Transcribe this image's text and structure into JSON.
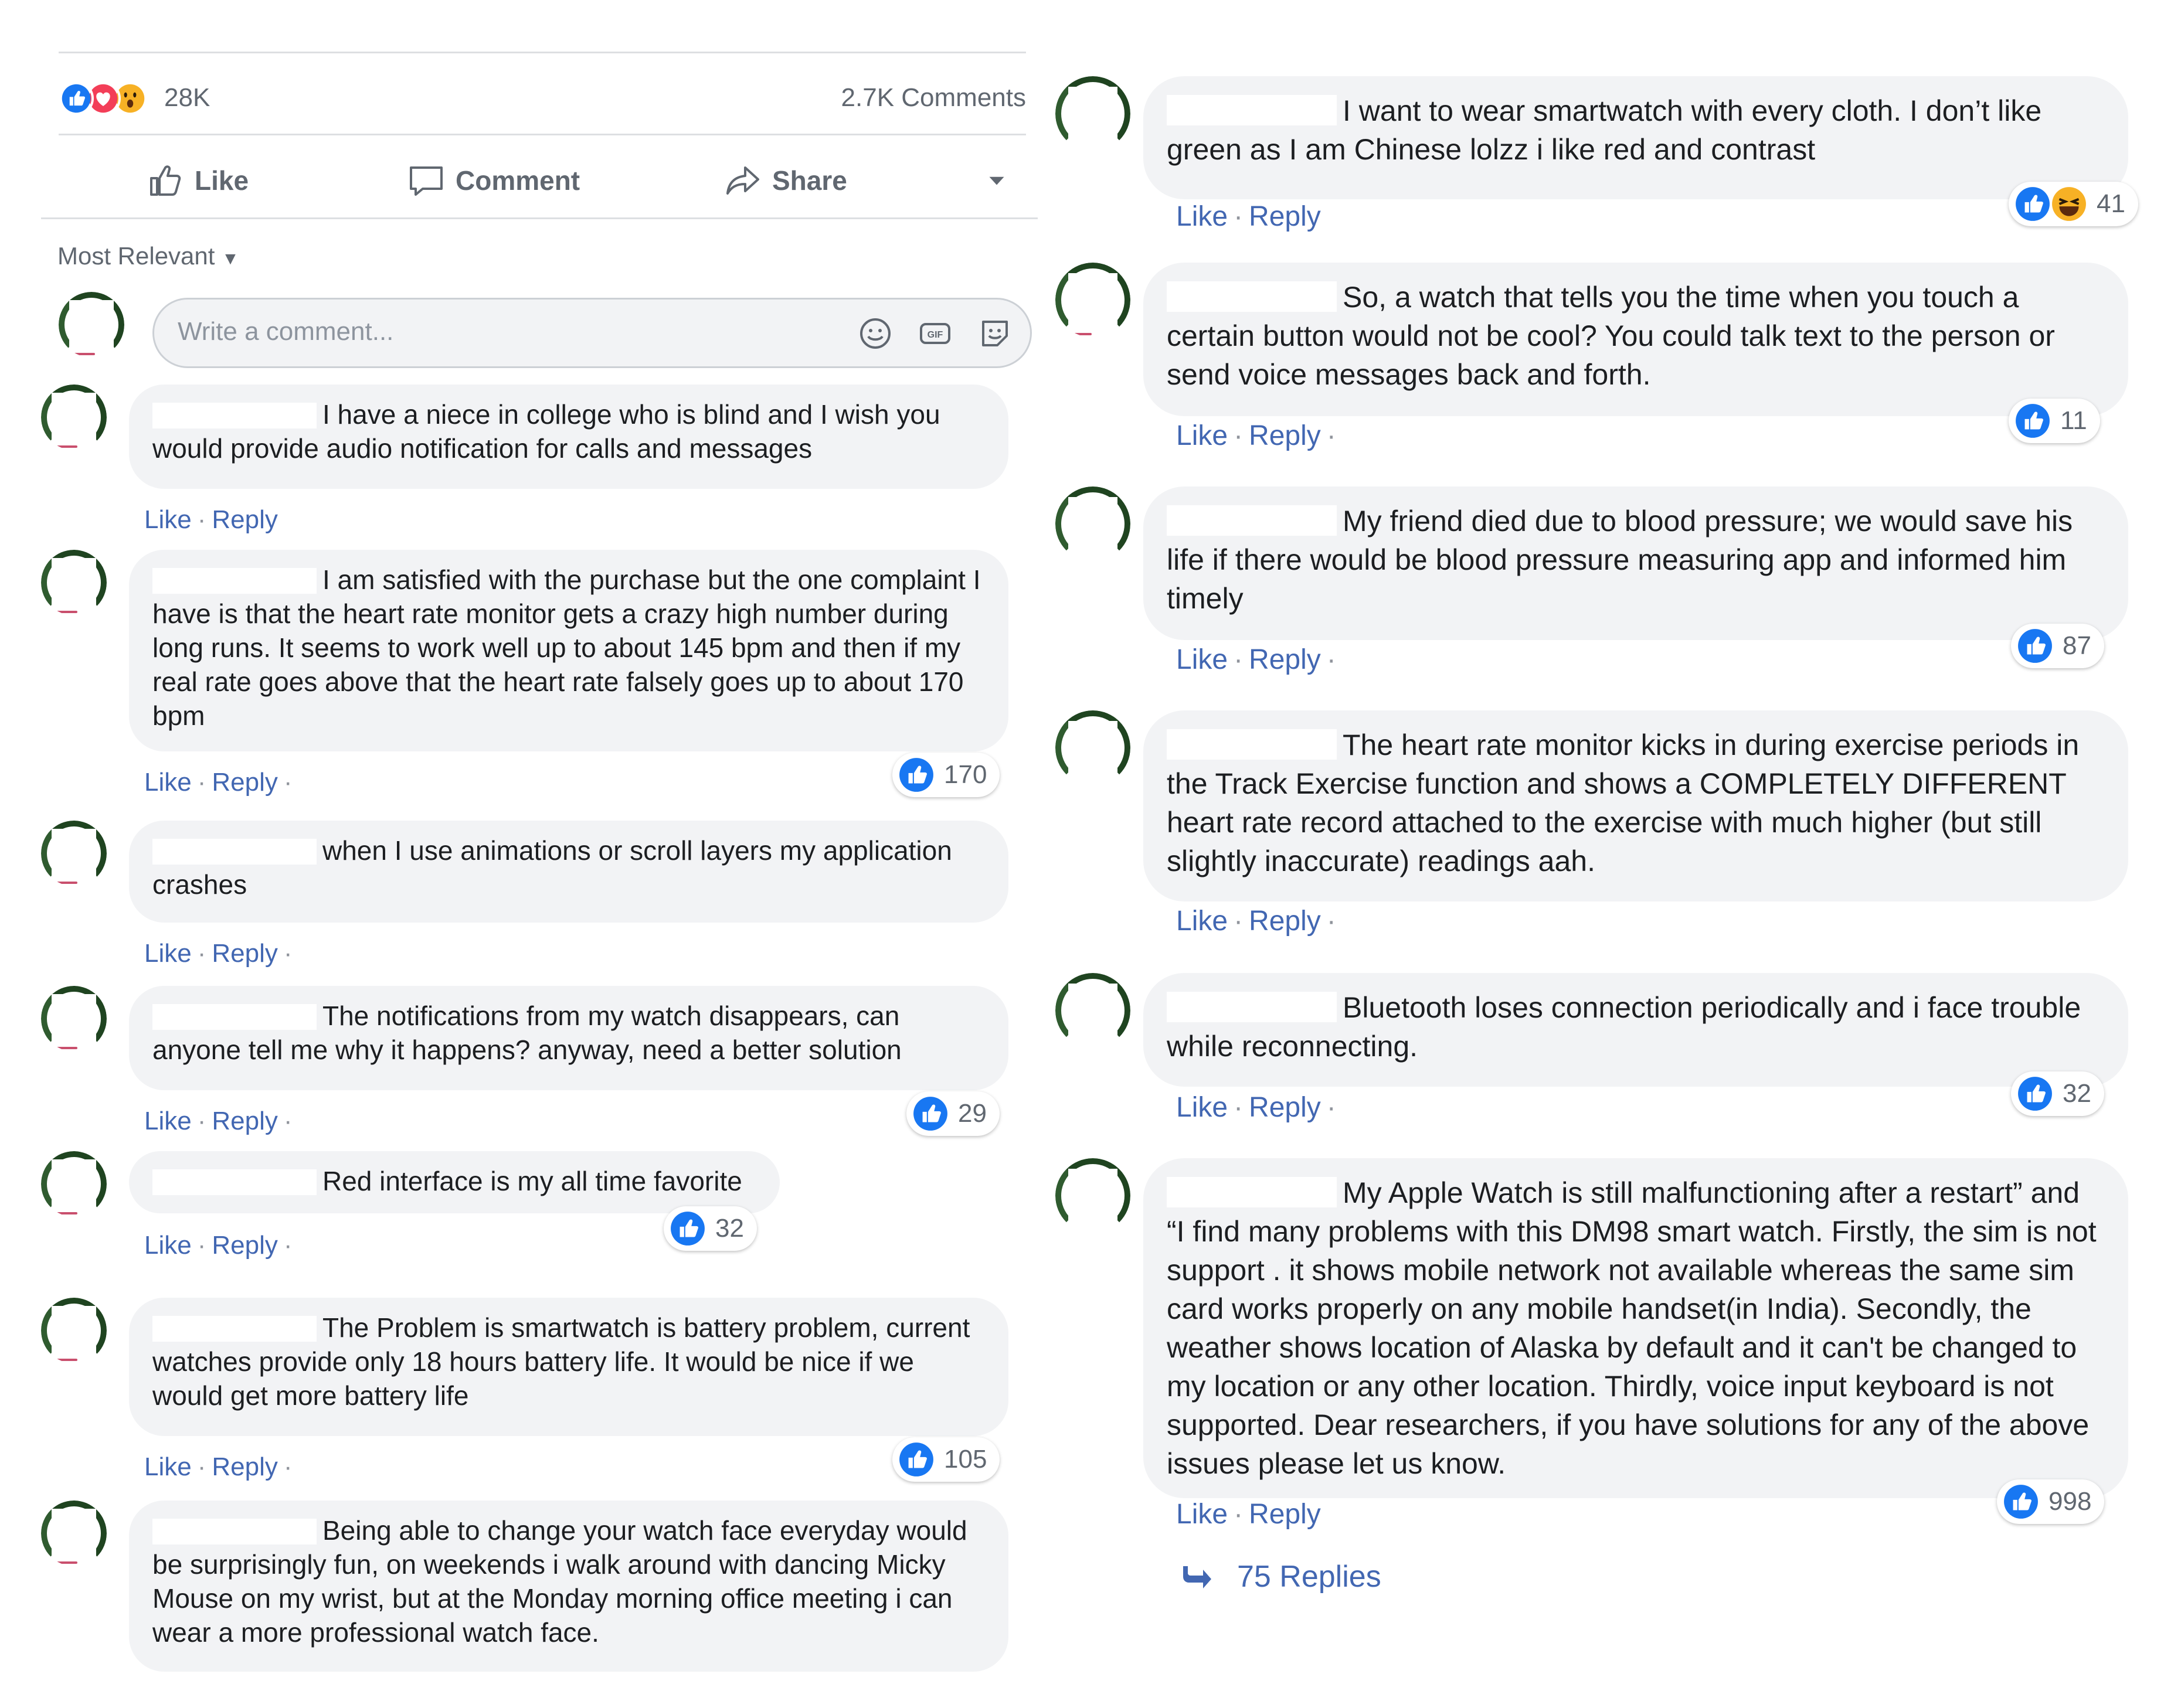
{
  "summary": {
    "reaction_count": "28K",
    "comments_count": "2.7K Comments",
    "reaction_icons": [
      "like-icon",
      "love-icon",
      "wow-icon"
    ]
  },
  "actions": {
    "like": "Like",
    "comment": "Comment",
    "share": "Share"
  },
  "sort": {
    "label": "Most Relevant"
  },
  "composer": {
    "placeholder": "Write a comment..."
  },
  "link_labels": {
    "like": "Like",
    "reply": "Reply",
    "dot": "·"
  },
  "left_comments": [
    {
      "text": "I have a niece in college who is blind and I wish you would provide audio notification for calls and messages",
      "likes": ""
    },
    {
      "text": "I am satisfied with the purchase but the one complaint I have is that the heart rate monitor gets a crazy high number during long runs. It seems to work well up to about 145 bpm and then if my real rate goes above that the heart rate falsely goes up to about 170 bpm",
      "likes": "170"
    },
    {
      "text": "when I use animations or scroll layers my application crashes",
      "likes": ""
    },
    {
      "text": "The notifications from my watch disappears, can anyone tell me why it happens? anyway, need a better solution",
      "likes": "29"
    },
    {
      "text": "Red interface is my all time favorite",
      "likes": "32"
    },
    {
      "text": "The Problem is smartwatch is battery problem, current watches provide only 18 hours battery life. It would be nice if we would get more battery life",
      "likes": "105"
    },
    {
      "text": "Being able to change your watch face everyday would be surprisingly fun, on weekends i walk around with dancing Micky Mouse on my wrist, but at the Monday morning office meeting i can wear a more professional watch face.",
      "likes": ""
    }
  ],
  "right_comments": [
    {
      "text": "I want to wear smartwatch with every cloth. I don’t like green as I am Chinese lolzz i like red and contrast",
      "likes": "41"
    },
    {
      "text": "So, a watch that tells you the time when you touch a certain button would not be cool? You could talk text to the person or send voice messages back and forth.",
      "likes": "11"
    },
    {
      "text": "My friend died due to blood pressure; we would save his life if there would be blood pressure measuring app and informed him timely",
      "likes": "87"
    },
    {
      "text": "The heart rate monitor kicks in during exercise periods in the Track Exercise function and shows a COMPLETELY DIFFERENT heart rate record attached to the exercise with much higher (but still slightly inaccurate) readings aah.",
      "likes": ""
    },
    {
      "text": "Bluetooth loses connection periodically and i face trouble while reconnecting.",
      "likes": "32"
    },
    {
      "text": "My Apple Watch is still malfunctioning after a restart” and “I find many problems with this DM98 smart watch. Firstly, the sim is not support . it shows mobile network not available whereas the same sim card works properly on any mobile handset(in India). Secondly, the weather shows location of Alaska by default and it can't be changed to my location or any other location. Thirdly, voice input keyboard is not supported. Dear researchers, if you have solutions for any of the above issues please let us know.",
      "likes": "998"
    }
  ],
  "replies": {
    "label": "75 Replies"
  },
  "colors": {
    "link": "#4267b2",
    "bubble": "#f2f3f5",
    "like_blue": "#1877f2",
    "love_red": "#f33e58",
    "wow_yellow": "#f7b125"
  }
}
